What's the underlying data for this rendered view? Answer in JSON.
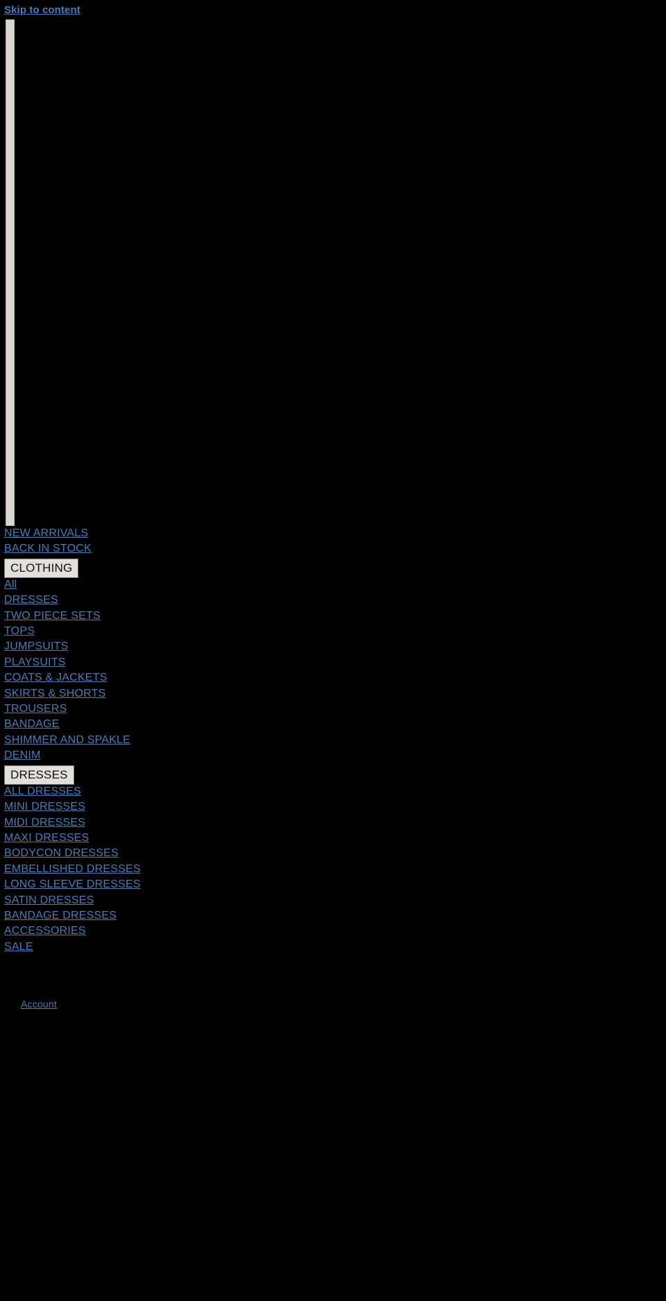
{
  "page": {
    "background_color": "#000000",
    "link_color": "#4a7cb5",
    "placeholder_color": "#d9d6cd",
    "disclosure_background": "#e2e0dc",
    "disclosure_text_color": "#111111"
  },
  "skip_link": {
    "label": "Skip to content"
  },
  "logo_placeholder": {
    "alt": ""
  },
  "nav": {
    "top_links": [
      {
        "label": "NEW ARRIVALS"
      },
      {
        "label": "BACK IN STOCK"
      }
    ],
    "groups": [
      {
        "summary": "CLOTHING",
        "items": [
          {
            "label": "All"
          },
          {
            "label": "DRESSES"
          },
          {
            "label": "TWO PIECE SETS"
          },
          {
            "label": "TOPS"
          },
          {
            "label": "JUMPSUITS"
          },
          {
            "label": "PLAYSUITS"
          },
          {
            "label": "COATS & JACKETS"
          },
          {
            "label": "SKIRTS & SHORTS"
          },
          {
            "label": "TROUSERS"
          },
          {
            "label": "BANDAGE"
          },
          {
            "label": "SHIMMER AND SPAKLE"
          },
          {
            "label": "DENIM"
          }
        ]
      },
      {
        "summary": "DRESSES",
        "items": [
          {
            "label": "ALL DRESSES"
          },
          {
            "label": "MINI DRESSES"
          },
          {
            "label": "MIDI DRESSES"
          },
          {
            "label": "MAXI DRESSES"
          },
          {
            "label": "BODYCON DRESSES"
          },
          {
            "label": "EMBELLISHED DRESSES"
          },
          {
            "label": "LONG SLEEVE DRESSES"
          },
          {
            "label": "SATIN DRESSES"
          },
          {
            "label": "BANDAGE DRESSES"
          }
        ]
      }
    ],
    "bottom_links": [
      {
        "label": "ACCESSORIES"
      },
      {
        "label": "SALE"
      }
    ]
  },
  "utility": {
    "account_label": "Account"
  }
}
